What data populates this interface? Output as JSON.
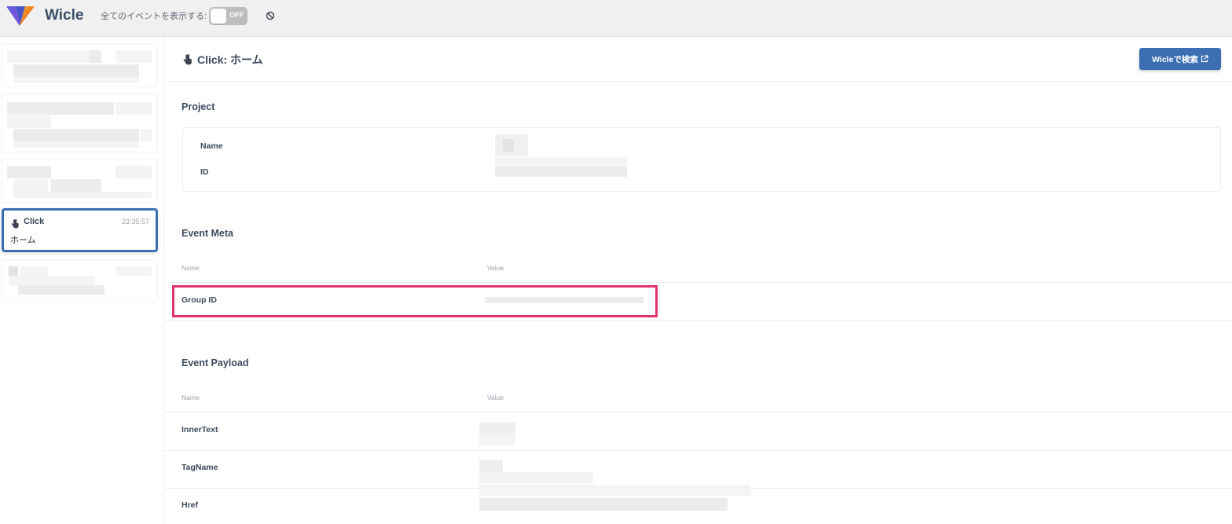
{
  "header": {
    "brand": "Wicle",
    "show_all_label": "全てのイベントを表示する:",
    "toggle_state": "OFF",
    "logo_icon": "wicle-logo",
    "clear_icon": "block-icon"
  },
  "sidebar": {
    "selected_event": {
      "type": "Click",
      "time": "23:35:57",
      "title": "ホーム",
      "icon": "pointer-hand-icon"
    }
  },
  "main": {
    "title": "Click: ホーム",
    "title_icon": "pointer-hand-icon",
    "search_button_label": "Wicleで検索",
    "search_button_icon": "external-link-icon",
    "project": {
      "heading": "Project",
      "name_label": "Name",
      "id_label": "ID"
    },
    "event_meta": {
      "heading": "Event Meta",
      "col_name": "Name",
      "col_value": "Value",
      "rows": [
        {
          "name": "Group ID"
        }
      ]
    },
    "event_payload": {
      "heading": "Event Payload",
      "col_name": "Name",
      "col_value": "Value",
      "rows": [
        {
          "name": "InnerText"
        },
        {
          "name": "TagName"
        },
        {
          "name": "Href"
        }
      ]
    }
  },
  "colors": {
    "accent": "#3b6fb2",
    "highlight": "#e0336f"
  }
}
